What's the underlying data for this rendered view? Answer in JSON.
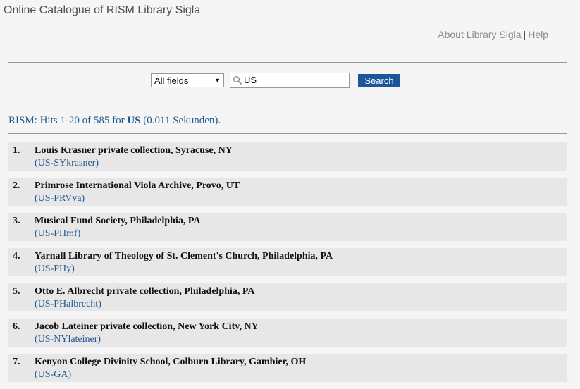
{
  "header": {
    "title": "Online Catalogue of RISM Library Sigla",
    "links": {
      "about": "About Library Sigla",
      "separator": "|",
      "help": "Help"
    }
  },
  "search": {
    "field_select": "All fields",
    "query": "US",
    "button": "Search"
  },
  "summary": {
    "prefix": "RISM: Hits 1-20 of 585 for",
    "term": "US",
    "suffix": "(0.011 Sekunden)."
  },
  "results": [
    {
      "num": "1.",
      "name": "Louis Krasner private collection, Syracuse, NY",
      "code": "(US-SYkrasner)"
    },
    {
      "num": "2.",
      "name": "Primrose International Viola Archive, Provo, UT",
      "code": "(US-PRVva)"
    },
    {
      "num": "3.",
      "name": "Musical Fund Society, Philadelphia, PA",
      "code": "(US-PHmf)"
    },
    {
      "num": "4.",
      "name": "Yarnall Library of Theology of St. Clement's Church, Philadelphia, PA",
      "code": "(US-PHy)"
    },
    {
      "num": "5.",
      "name": "Otto E. Albrecht private collection, Philadelphia, PA",
      "code": "(US-PHalbrecht)"
    },
    {
      "num": "6.",
      "name": "Jacob Lateiner private collection, New York City, NY",
      "code": "(US-NYlateiner)"
    },
    {
      "num": "7.",
      "name": "Kenyon College Divinity School, Colburn Library, Gambier, OH",
      "code": "(US-GA)"
    }
  ]
}
